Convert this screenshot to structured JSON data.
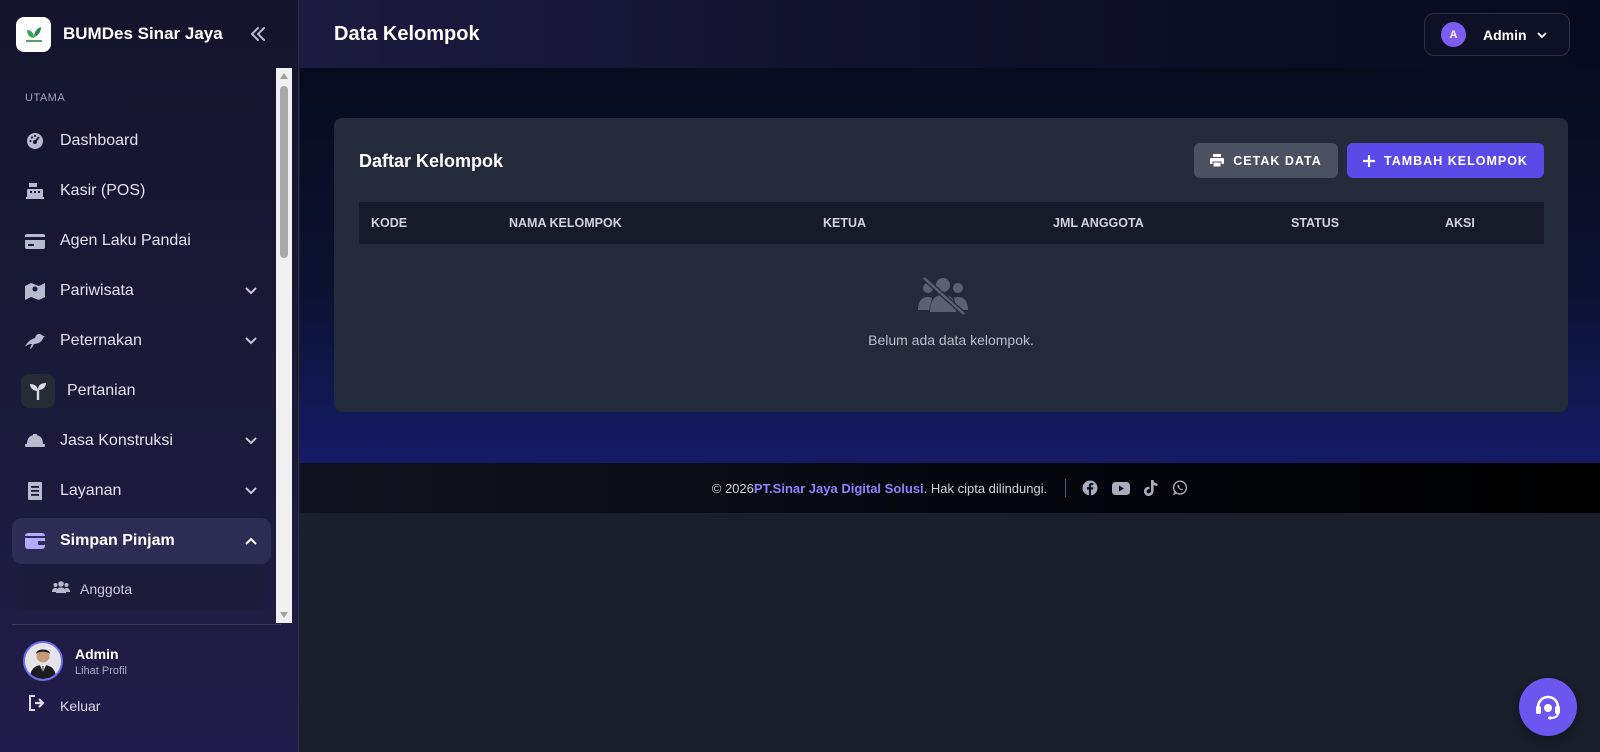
{
  "brand": {
    "name": "BUMDes Sinar Jaya"
  },
  "sidebar": {
    "section_label": "UTAMA",
    "items": [
      {
        "label": "Dashboard",
        "icon": "dashboard-icon"
      },
      {
        "label": "Kasir (POS)",
        "icon": "cash-register-icon"
      },
      {
        "label": "Agen Laku Pandai",
        "icon": "credit-card-icon"
      },
      {
        "label": "Pariwisata",
        "icon": "map-icon"
      },
      {
        "label": "Peternakan",
        "icon": "crow-icon"
      },
      {
        "label": "Pertanian",
        "icon": "seedling-icon"
      },
      {
        "label": "Jasa Konstruksi",
        "icon": "hard-hat-icon"
      },
      {
        "label": "Layanan",
        "icon": "document-icon"
      },
      {
        "label": "Simpan Pinjam",
        "icon": "wallet-icon"
      }
    ],
    "sub_items": [
      {
        "label": "Anggota",
        "icon": "users-icon"
      }
    ],
    "profile": {
      "name": "Admin",
      "link": "Lihat Profil"
    },
    "logout": "Keluar"
  },
  "header": {
    "title": "Data Kelompok",
    "user": {
      "initial": "A",
      "name": "Admin"
    }
  },
  "card": {
    "title": "Daftar Kelompok",
    "print_button": "CETAK DATA",
    "add_button": "TAMBAH KELOMPOK",
    "columns": [
      "KODE",
      "NAMA KELOMPOK",
      "KETUA",
      "JML ANGGOTA",
      "STATUS",
      "AKSI"
    ],
    "empty_text": "Belum ada data kelompok."
  },
  "footer": {
    "copyright_prefix": "© 2026 ",
    "company": "PT.Sinar Jaya Digital Solusi",
    "copyright_suffix": ". Hak cipta dilindungi.",
    "social": [
      "facebook-icon",
      "youtube-icon",
      "tiktok-icon",
      "whatsapp-icon"
    ]
  },
  "colors": {
    "accent": "#5a4ae8",
    "sidebar_active": "#2d2c55",
    "card_bg": "#232b3a"
  }
}
